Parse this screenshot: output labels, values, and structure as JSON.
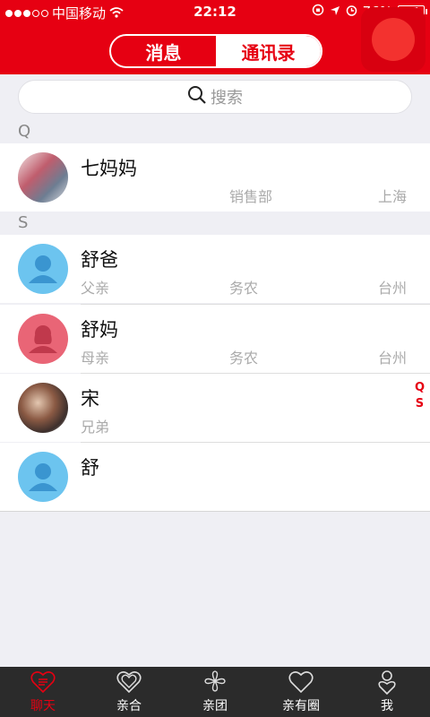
{
  "status_bar": {
    "carrier": "中国移动",
    "time": "22:12",
    "battery": "76%",
    "battery_level": 0.76
  },
  "header": {
    "tabs": [
      {
        "label": "消息",
        "active": false
      },
      {
        "label": "通讯录",
        "active": true
      }
    ]
  },
  "search": {
    "placeholder": "搜索",
    "icon": "search-icon"
  },
  "sections": [
    {
      "letter": "Q",
      "contacts": [
        {
          "name": "七妈妈",
          "relation": "",
          "department": "销售部",
          "city": "上海",
          "avatar": "photo"
        }
      ]
    },
    {
      "letter": "S",
      "contacts": [
        {
          "name": "舒爸",
          "relation": "父亲",
          "department": "务农",
          "city": "台州",
          "avatar": "male-placeholder"
        },
        {
          "name": "舒妈",
          "relation": "母亲",
          "department": "务农",
          "city": "台州",
          "avatar": "female-placeholder"
        },
        {
          "name": "宋",
          "relation": "兄弟",
          "department": "",
          "city": "",
          "avatar": "photo"
        },
        {
          "name": "舒",
          "relation": "",
          "department": "",
          "city": "",
          "avatar": "male-placeholder"
        }
      ]
    }
  ],
  "index_bar": [
    "Q",
    "S"
  ],
  "tab_bar": [
    {
      "label": "聊天",
      "icon": "chat-heart-icon",
      "active": true
    },
    {
      "label": "亲合",
      "icon": "double-heart-icon",
      "active": false
    },
    {
      "label": "亲团",
      "icon": "clover-icon",
      "active": false
    },
    {
      "label": "亲有圈",
      "icon": "heart-icon",
      "active": false
    },
    {
      "label": "我",
      "icon": "profile-icon",
      "active": false
    }
  ],
  "colors": {
    "brand": "#e60012",
    "tabbar_bg": "#2b2b2b"
  }
}
